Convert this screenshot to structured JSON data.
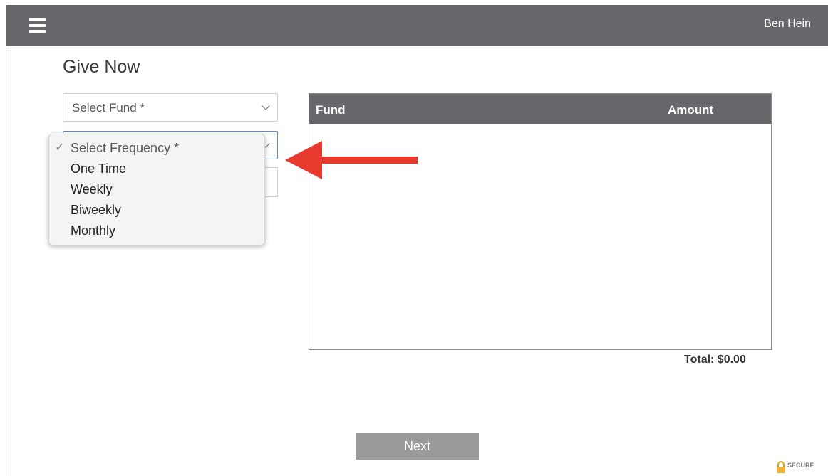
{
  "header": {
    "menu_icon": "hamburger-menu-icon",
    "user_name": "Ben Hein",
    "background_color": "#67666a"
  },
  "form": {
    "title": "Give Now",
    "fund_select": {
      "value": "Select Fund *"
    },
    "frequency_select": {
      "value": "Select Frequency *",
      "open": true,
      "options": [
        "Select Frequency *",
        "One Time",
        "Weekly",
        "Biweekly",
        "Monthly"
      ],
      "selected_index": 0
    }
  },
  "summary_table": {
    "columns": [
      "Fund",
      "Amount"
    ],
    "rows": [],
    "total": "Total: $0.00"
  },
  "actions": {
    "next_label": "Next"
  },
  "badge": {
    "label": "SECURE",
    "icon": "padlock-icon"
  },
  "colors": {
    "arrow": "#e8392f",
    "next_button": "#9a9a9a",
    "focus_border": "#5b8bd8"
  }
}
